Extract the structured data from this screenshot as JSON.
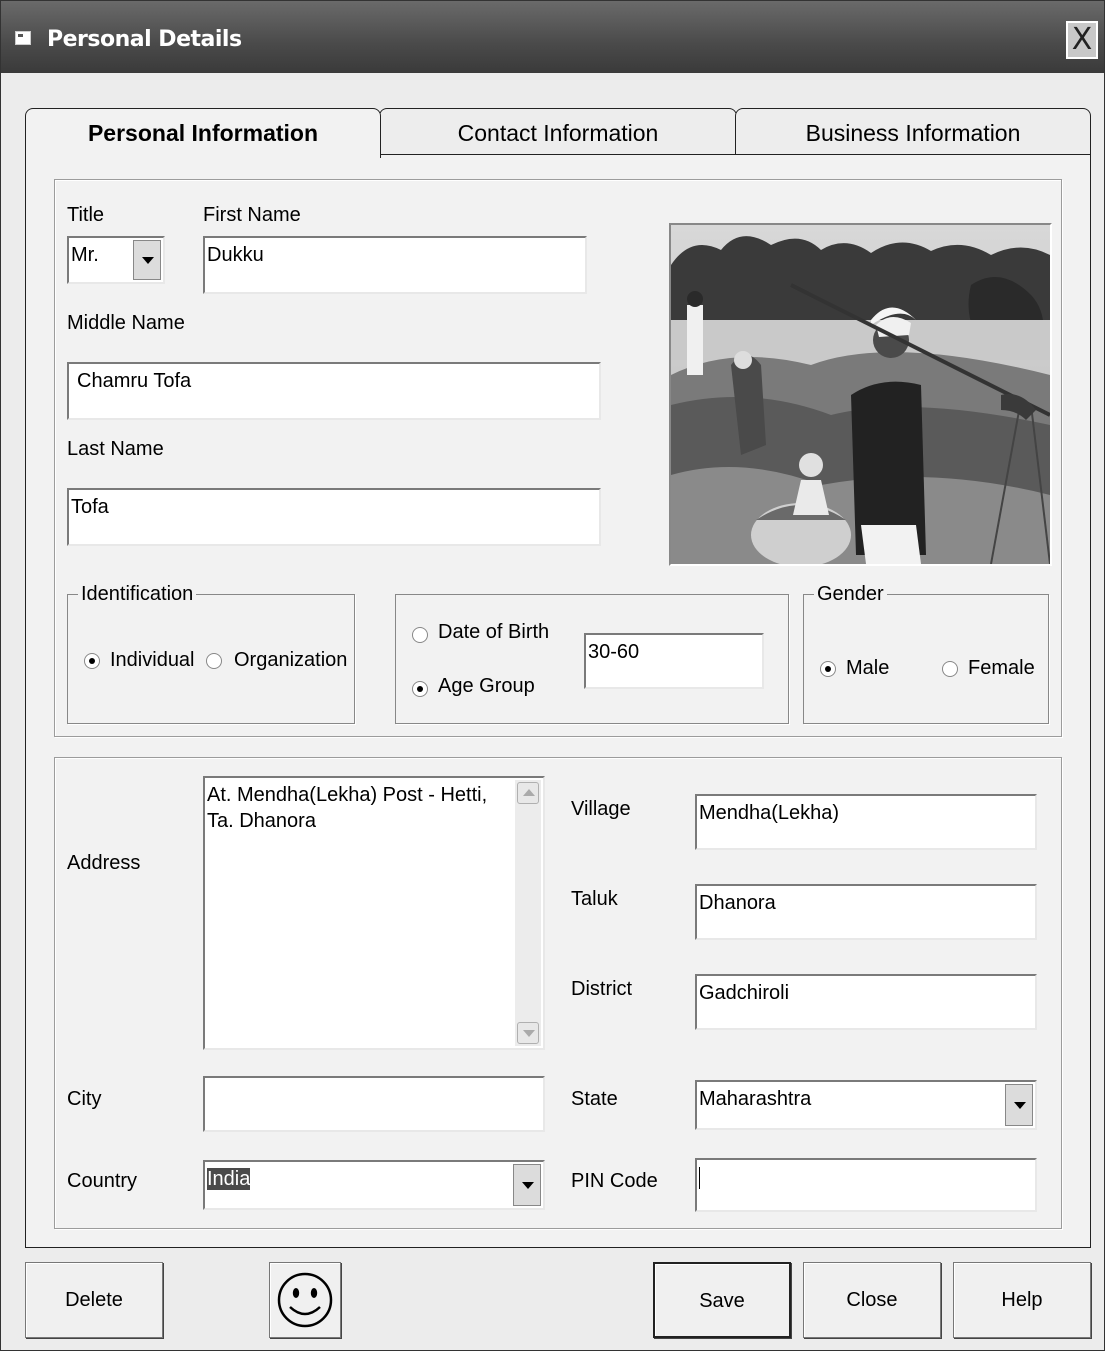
{
  "window": {
    "title": "Personal Details",
    "close_label": "X"
  },
  "tabs": [
    {
      "label": "Personal Information",
      "active": true
    },
    {
      "label": "Contact Information",
      "active": false
    },
    {
      "label": "Business Information",
      "active": false
    }
  ],
  "name": {
    "title_label": "Title",
    "title_value": "Mr.",
    "first_label": "First Name",
    "first_value": "Dukku",
    "middle_label": "Middle Name",
    "middle_value": "Chamru Tofa",
    "last_label": "Last Name",
    "last_value": "Tofa"
  },
  "identification": {
    "legend": "Identification",
    "options": [
      "Individual",
      "Organization"
    ],
    "selected": "Individual"
  },
  "age": {
    "dob_label": "Date of Birth",
    "group_label": "Age Group",
    "selected": "Age Group",
    "value": "30-60"
  },
  "gender": {
    "legend": "Gender",
    "options": [
      "Male",
      "Female"
    ],
    "selected": "Male"
  },
  "address": {
    "address_label": "Address",
    "address_value": "At. Mendha(Lekha) Post - Hetti, Ta. Dhanora",
    "village_label": "Village",
    "village_value": "Mendha(Lekha)",
    "taluk_label": "Taluk",
    "taluk_value": "Dhanora",
    "district_label": "District",
    "district_value": "Gadchiroli",
    "city_label": "City",
    "city_value": "",
    "state_label": "State",
    "state_value": "Maharashtra",
    "country_label": "Country",
    "country_value": "India",
    "pin_label": "PIN Code",
    "pin_value": ""
  },
  "buttons": {
    "delete": "Delete",
    "save": "Save",
    "close": "Close",
    "help": "Help"
  }
}
